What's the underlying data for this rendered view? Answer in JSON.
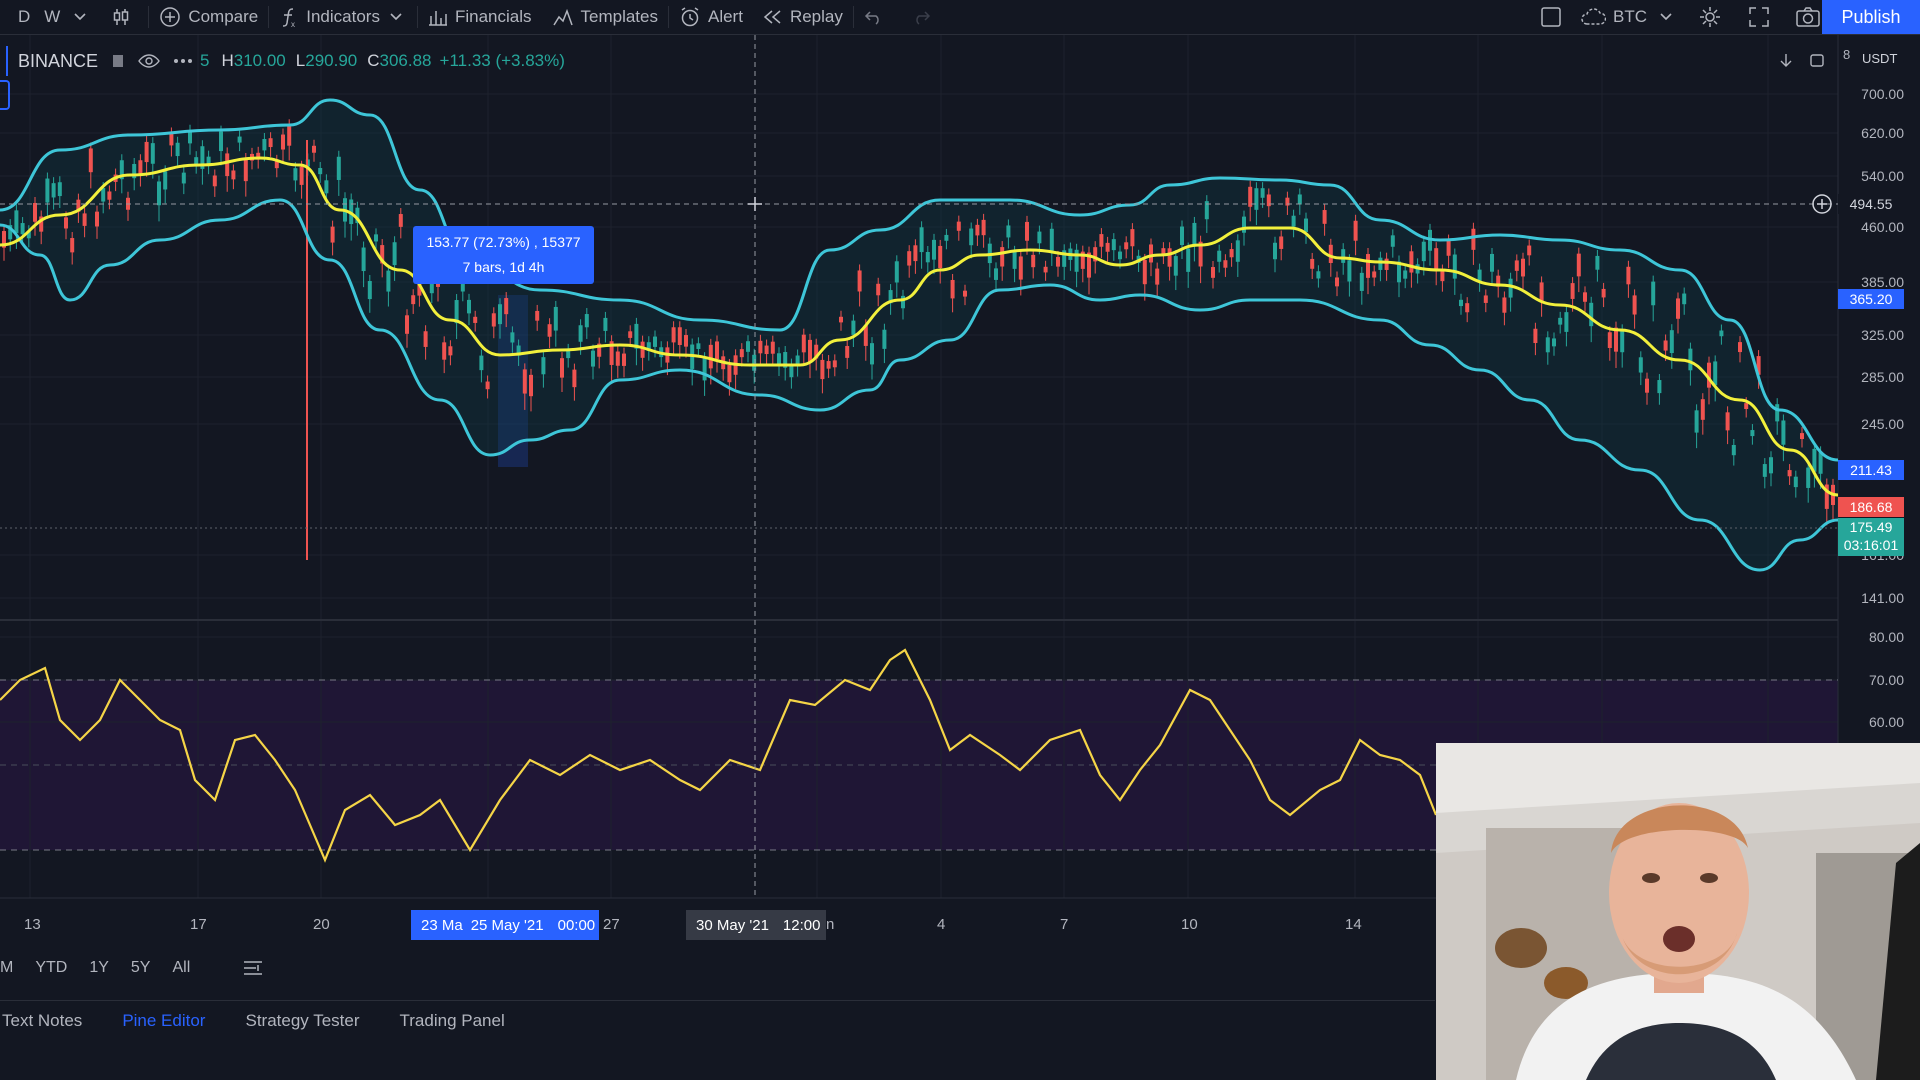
{
  "toolbar": {
    "interval_d": "D",
    "interval_w": "W",
    "compare": "Compare",
    "indicators": "Indicators",
    "financials": "Financials",
    "templates": "Templates",
    "alert": "Alert",
    "replay": "Replay",
    "symbol": "BTC",
    "publish": "Publish"
  },
  "legend": {
    "exchange": "BINANCE",
    "partial_open": "5",
    "h_label": "H",
    "h_value": "310.00",
    "l_label": "L",
    "l_value": "290.90",
    "c_label": "C",
    "c_value": "306.88",
    "change": "+11.33 (+3.83%)"
  },
  "measure_tooltip": {
    "line1": "153.77 (72.73%) , 15377",
    "line2": "7 bars, 1d 4h"
  },
  "price_axis": {
    "currency": "USDT",
    "top_partial": "8",
    "labels": [
      "700.00",
      "620.00",
      "540.00",
      "460.00",
      "385.00",
      "325.00",
      "285.00",
      "245.00",
      "141.00"
    ],
    "crosshair_price": "494.55",
    "tag_365": "365.20",
    "tag_211": "211.43",
    "tag_186": "186.68",
    "tag_175": "175.49",
    "tag_countdown": "03:16:01",
    "hidden_partial": "161.00"
  },
  "rsi_axis": {
    "labels": [
      "80.00",
      "70.00",
      "60.00"
    ]
  },
  "time_axis": {
    "labels": [
      "13",
      "17",
      "20",
      "27",
      "4",
      "7",
      "10",
      "14"
    ],
    "measure_start": "23 Ma",
    "measure_end": "25 May '21",
    "measure_time": "00:00",
    "crosshair_date": "30 May '21",
    "crosshair_time": "12:00",
    "crosshair_tail": "n"
  },
  "range_bar": [
    "M",
    "YTD",
    "1Y",
    "5Y",
    "All"
  ],
  "bottom_tabs": [
    "Text Notes",
    "Pine Editor",
    "Strategy Tester",
    "Trading Panel"
  ],
  "colors": {
    "background": "#131722",
    "bollinger": "#3ec6d8",
    "basis": "#f2f03c",
    "rsi": "#f5d547",
    "up": "#26a69a",
    "down": "#ef5350",
    "accent": "#2962ff"
  }
}
